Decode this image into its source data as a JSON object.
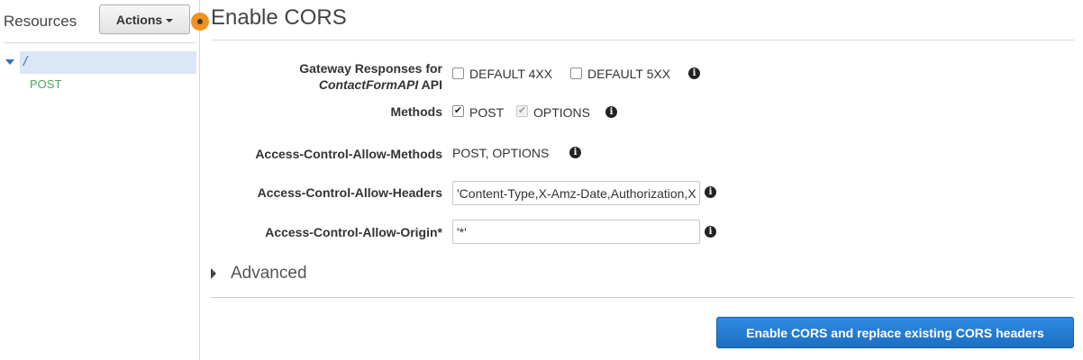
{
  "sidebar": {
    "title": "Resources",
    "actions_label": "Actions",
    "root_path": "/",
    "methods": [
      "POST"
    ]
  },
  "main": {
    "title": "Enable CORS",
    "gateway_responses": {
      "label_prefix": "Gateway Responses for",
      "api_name": "ContactFormAPI",
      "label_suffix": "API",
      "options": [
        {
          "label": "DEFAULT 4XX",
          "checked": false
        },
        {
          "label": "DEFAULT 5XX",
          "checked": false
        }
      ]
    },
    "methods": {
      "label": "Methods",
      "options": [
        {
          "label": "POST",
          "checked": true,
          "disabled": false
        },
        {
          "label": "OPTIONS",
          "checked": true,
          "disabled": true
        }
      ]
    },
    "allow_methods": {
      "label": "Access-Control-Allow-Methods",
      "value": "POST, OPTIONS"
    },
    "allow_headers": {
      "label": "Access-Control-Allow-Headers",
      "value": "'Content-Type,X-Amz-Date,Authorization,X-Api-Key,X-Amz-Security-Token'"
    },
    "allow_origin": {
      "label": "Access-Control-Allow-Origin*",
      "value": "'*'"
    },
    "advanced_label": "Advanced",
    "submit_label": "Enable CORS and replace existing CORS headers"
  },
  "colors": {
    "accent_blue": "#2e73b8",
    "method_green": "#4aa85c",
    "primary_button": "#1b6fc4",
    "handle_orange": "#f0921e"
  }
}
